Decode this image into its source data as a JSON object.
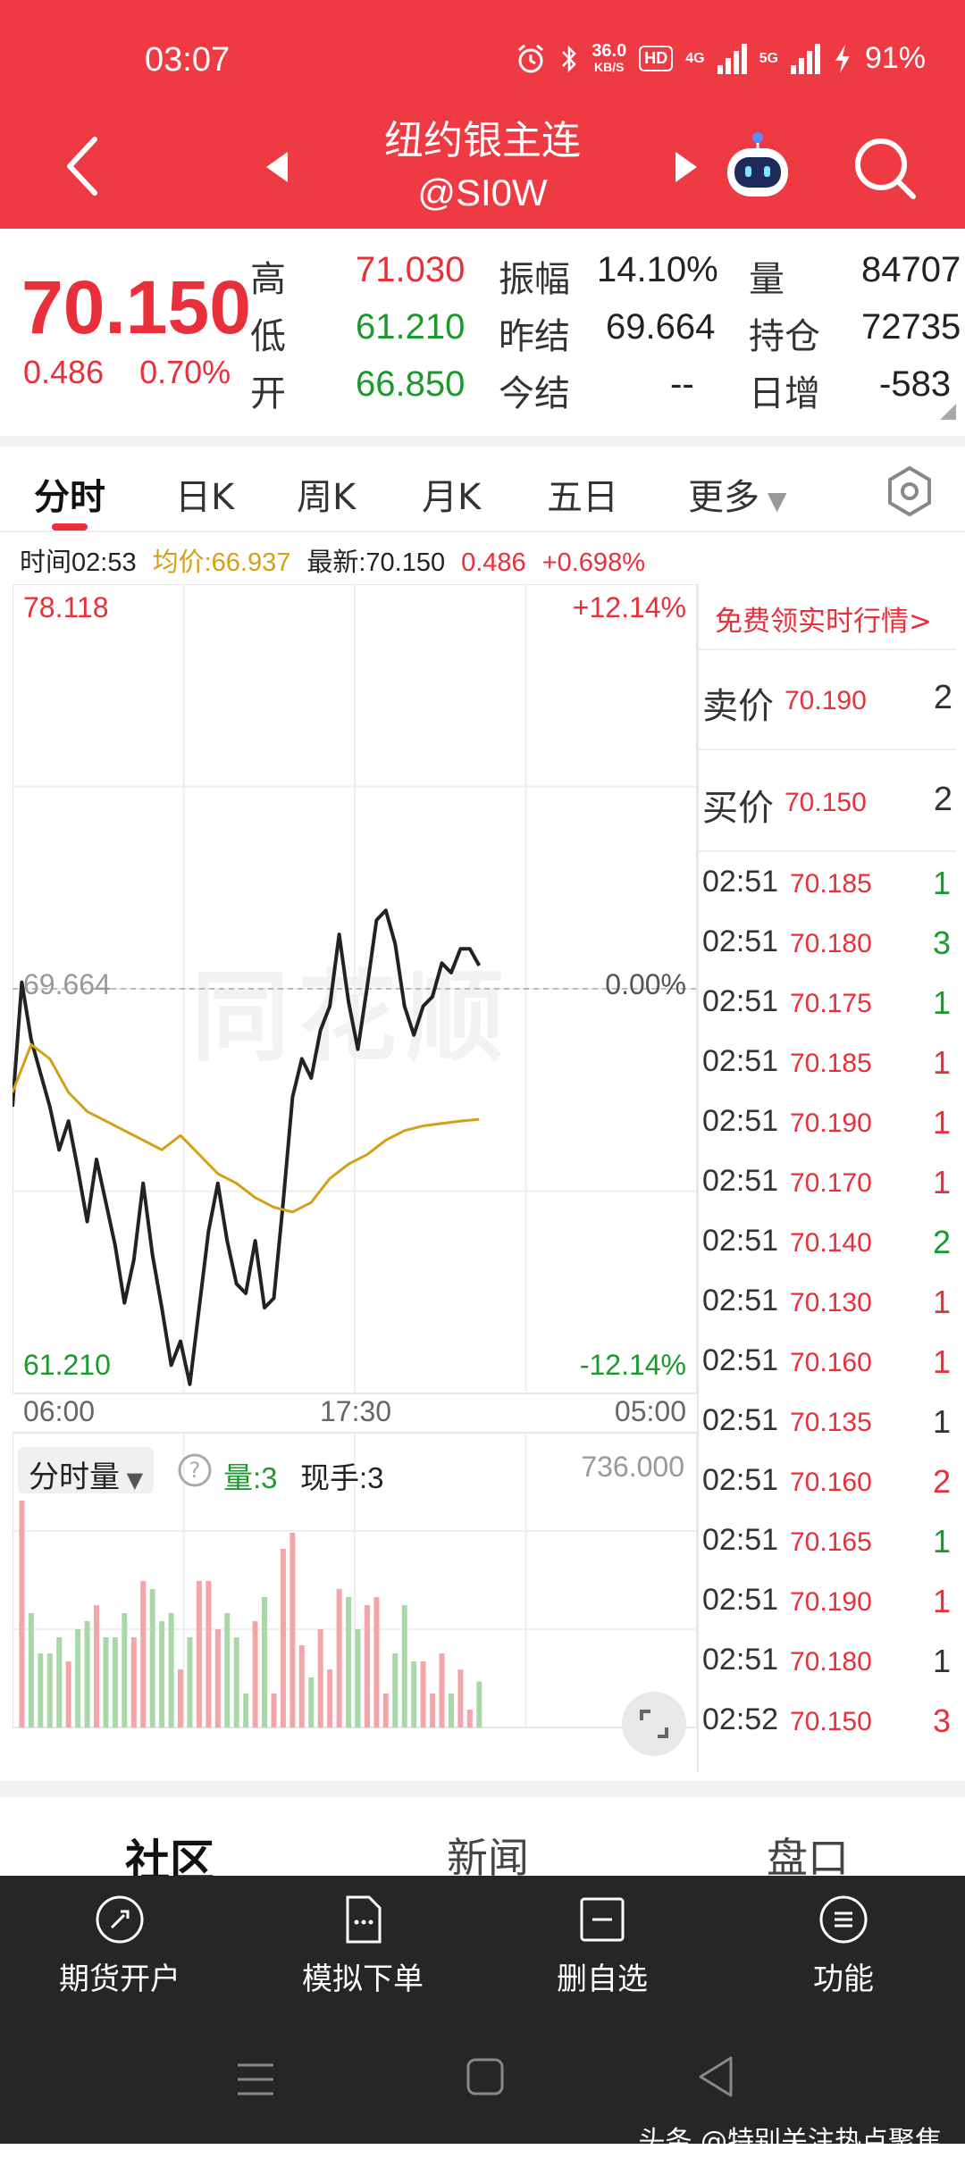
{
  "status": {
    "time": "03:07",
    "net_speed_top": "36.0",
    "net_speed_unit": "KB/S",
    "hd": "HD",
    "net_4g": "4G",
    "net_5g": "5G",
    "battery": "91%"
  },
  "header": {
    "title": "纽约银主连",
    "code": "@SI0W"
  },
  "quote": {
    "last": "70.150",
    "change": "0.486",
    "change_pct": "0.70%",
    "high_label": "高",
    "high": "71.030",
    "low_label": "低",
    "low": "61.210",
    "open_label": "开",
    "open": "66.850",
    "amp_label": "振幅",
    "amp": "14.10%",
    "prev_settle_label": "昨结",
    "prev_settle": "69.664",
    "settle_label": "今结",
    "settle": "--",
    "vol_label": "量",
    "vol": "84707",
    "oi_label": "持仓",
    "oi": "72735",
    "oi_chg_label": "日增",
    "oi_chg": "-583"
  },
  "tabs": [
    "分时",
    "日K",
    "周K",
    "月K",
    "五日",
    "更多"
  ],
  "info": {
    "time": "时间02:53",
    "avg": "均价:66.937",
    "latest": "最新:70.150",
    "chg": "0.486",
    "chg_pct": "+0.698%"
  },
  "chart_data": {
    "type": "line",
    "title": "",
    "y_top_label": "78.118",
    "y_top_pct": "+12.14%",
    "y_bottom_label": "61.210",
    "y_bottom_pct": "-12.14%",
    "ref_label": "69.664",
    "ref_pct": "0.00%",
    "ylim": [
      61.21,
      78.118
    ],
    "x_labels": [
      "06:00",
      "17:30",
      "05:00"
    ],
    "series": [
      {
        "name": "",
        "color": "#222222",
        "x": [
          0,
          3,
          6,
          9,
          12,
          15,
          18,
          21,
          24,
          27,
          30,
          33,
          36,
          39,
          42,
          45,
          48,
          51,
          54,
          57,
          60,
          63,
          66,
          69,
          72,
          75,
          78,
          81,
          84,
          87,
          90,
          93,
          96,
          99,
          102,
          105,
          108,
          111,
          114,
          117,
          120,
          123,
          126,
          129,
          132,
          135,
          138,
          141,
          144,
          147,
          150
        ],
        "values": [
          67.2,
          69.8,
          68.6,
          67.9,
          67.2,
          66.3,
          66.9,
          65.9,
          64.8,
          66.1,
          65.2,
          64.3,
          63.1,
          64.0,
          65.6,
          64.1,
          63.0,
          61.8,
          62.3,
          61.4,
          63.0,
          64.6,
          65.6,
          64.4,
          63.5,
          63.3,
          64.4,
          63.0,
          63.2,
          65.2,
          67.4,
          68.2,
          67.8,
          68.8,
          69.3,
          70.8,
          69.4,
          68.4,
          69.7,
          71.1,
          71.3,
          70.6,
          69.3,
          68.7,
          69.3,
          69.5,
          70.2,
          70.0,
          70.5,
          70.5,
          70.15
        ]
      },
      {
        "name": "",
        "color": "#d4a017",
        "x": [
          0,
          6,
          12,
          18,
          24,
          30,
          36,
          42,
          48,
          54,
          60,
          66,
          72,
          78,
          84,
          90,
          96,
          102,
          108,
          114,
          120,
          126,
          132,
          138,
          144,
          150
        ],
        "values": [
          67.5,
          68.5,
          68.2,
          67.5,
          67.1,
          66.9,
          66.7,
          66.5,
          66.3,
          66.6,
          66.2,
          65.8,
          65.6,
          65.3,
          65.1,
          65.0,
          65.2,
          65.7,
          66.0,
          66.2,
          66.5,
          66.7,
          66.8,
          66.85,
          66.9,
          66.937
        ]
      }
    ],
    "volume_panel": {
      "label": "分时量",
      "vol_label": "量:3",
      "hand_label": "现手:3",
      "max_label": "736.000"
    }
  },
  "book": {
    "free_quote": "免费领实时行情>",
    "ask": {
      "label": "卖价",
      "price": "70.190",
      "vol": "2"
    },
    "bid": {
      "label": "买价",
      "price": "70.150",
      "vol": "2"
    },
    "ticks": [
      {
        "t": "02:51",
        "p": "70.185",
        "v": "1",
        "c": "#1a9a2c"
      },
      {
        "t": "02:51",
        "p": "70.180",
        "v": "3",
        "c": "#1a9a2c"
      },
      {
        "t": "02:51",
        "p": "70.175",
        "v": "1",
        "c": "#1a9a2c"
      },
      {
        "t": "02:51",
        "p": "70.185",
        "v": "1",
        "c": "#e8303a"
      },
      {
        "t": "02:51",
        "p": "70.190",
        "v": "1",
        "c": "#e8303a"
      },
      {
        "t": "02:51",
        "p": "70.170",
        "v": "1",
        "c": "#e8303a"
      },
      {
        "t": "02:51",
        "p": "70.140",
        "v": "2",
        "c": "#1a9a2c"
      },
      {
        "t": "02:51",
        "p": "70.130",
        "v": "1",
        "c": "#e8303a"
      },
      {
        "t": "02:51",
        "p": "70.160",
        "v": "1",
        "c": "#e8303a"
      },
      {
        "t": "02:51",
        "p": "70.135",
        "v": "1",
        "c": "#333333"
      },
      {
        "t": "02:51",
        "p": "70.160",
        "v": "2",
        "c": "#e8303a"
      },
      {
        "t": "02:51",
        "p": "70.165",
        "v": "1",
        "c": "#1a9a2c"
      },
      {
        "t": "02:51",
        "p": "70.190",
        "v": "1",
        "c": "#e8303a"
      },
      {
        "t": "02:51",
        "p": "70.180",
        "v": "1",
        "c": "#333333"
      },
      {
        "t": "02:52",
        "p": "70.150",
        "v": "3",
        "c": "#e8303a"
      }
    ]
  },
  "section_tabs": [
    "社区",
    "新闻",
    "盘口"
  ],
  "actions": [
    "期货开户",
    "模拟下单",
    "删自选",
    "功能"
  ],
  "credit": "头条 @特别关注热点聚焦"
}
